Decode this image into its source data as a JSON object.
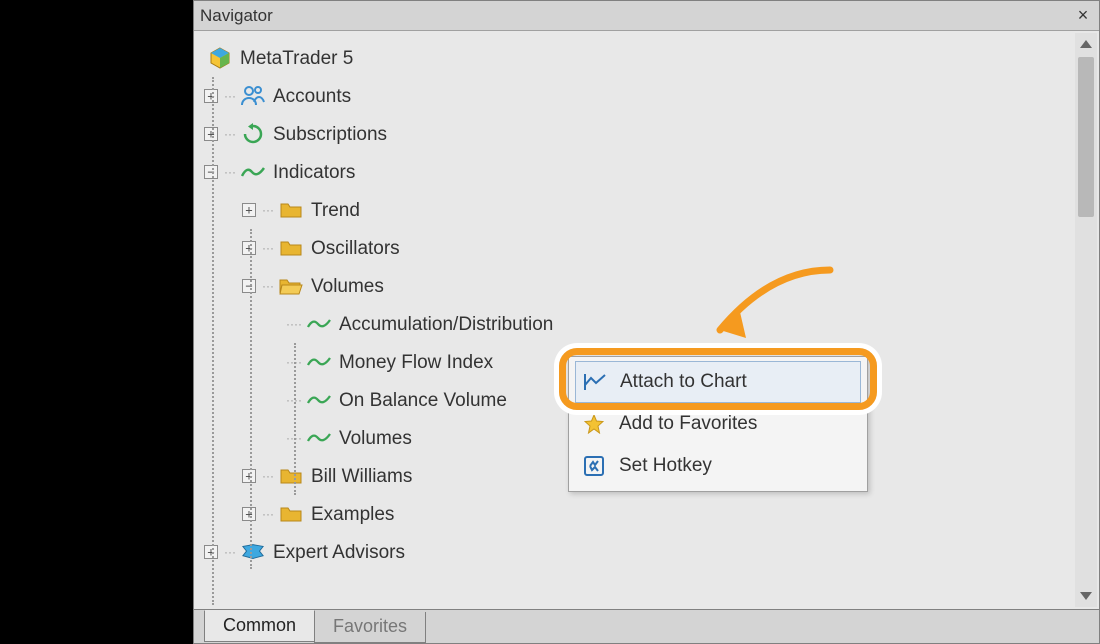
{
  "panel": {
    "title": "Navigator"
  },
  "tree": {
    "root": "MetaTrader 5",
    "accounts": "Accounts",
    "subscriptions": "Subscriptions",
    "indicators": "Indicators",
    "trend": "Trend",
    "oscillators": "Oscillators",
    "volumes": "Volumes",
    "accdist": "Accumulation/Distribution",
    "mfi": "Money Flow Index",
    "obv": "On Balance Volume",
    "vol": "Volumes",
    "billwilliams": "Bill Williams",
    "examples": "Examples",
    "ea": "Expert Advisors"
  },
  "ctx": {
    "attach": "Attach to Chart",
    "fav": "Add to Favorites",
    "hotkey": "Set Hotkey"
  },
  "tabs": {
    "common": "Common",
    "favorites": "Favorites"
  }
}
